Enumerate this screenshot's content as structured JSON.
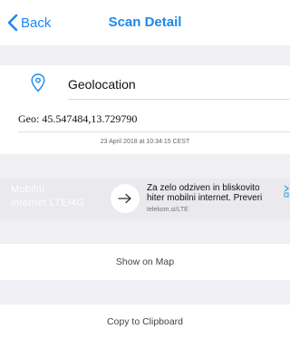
{
  "nav": {
    "back_label": "Back",
    "title": "Scan Detail"
  },
  "geo": {
    "label": "Geolocation",
    "coordinates": "Geo: 45.547484,13.729790",
    "timestamp": "23 April 2018 at 10:34:15 CEST"
  },
  "ad": {
    "left_line1": "Mobilni",
    "left_line2": "internet LTE/4G",
    "text_line1": "Za zelo odziven in bliskovito",
    "text_line2": "hiter mobilni internet. Preveri",
    "url": "telekom.si/LTE"
  },
  "actions": {
    "show_on_map": "Show on Map",
    "copy_to_clipboard": "Copy to Clipboard"
  },
  "colors": {
    "accent": "#1e88f0",
    "grouped_background": "#efeff4"
  },
  "icons": {
    "back": "chevron-left-icon",
    "location": "map-pin-icon",
    "ad_arrow": "arrow-right-icon",
    "ad_info": "ad-choices-icon"
  }
}
